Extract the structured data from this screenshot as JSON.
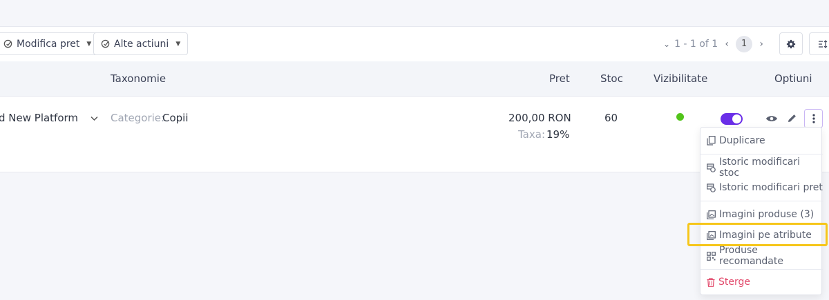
{
  "toolbar": {
    "modifica_pret_label": "Modifica pret",
    "alte_actiuni_label": "Alte actiuni",
    "pagination_text": "1 - 1 of 1",
    "current_page": "1"
  },
  "table": {
    "columns": [
      "Taxonomie",
      "Pret",
      "Stoc",
      "Vizibilitate",
      "Optiuni"
    ],
    "rows": [
      {
        "product_name": "d New Platform",
        "category_label": "Categorie:",
        "category_value": "Copii",
        "price": "200,00 RON",
        "tax_label": "Taxa:",
        "tax_value": "19%",
        "stock": "60"
      }
    ]
  },
  "menu": {
    "items": [
      {
        "label": "Duplicare",
        "icon": "copy-icon"
      },
      {
        "label": "Istoric modificari stoc",
        "icon": "history-icon"
      },
      {
        "label": "Istoric modificari pret",
        "icon": "history-icon"
      },
      {
        "label": "Imagini produse (3)",
        "icon": "images-icon"
      },
      {
        "label": "Imagini pe atribute",
        "icon": "images-icon"
      },
      {
        "label": "Produse recomandate",
        "icon": "qr-grid-icon"
      },
      {
        "label": "Sterge",
        "icon": "trash-icon"
      }
    ]
  },
  "colors": {
    "accent": "#6a2ee8",
    "visible_dot": "#52c41a",
    "danger": "#e2496b",
    "highlight": "#f6c61a"
  }
}
